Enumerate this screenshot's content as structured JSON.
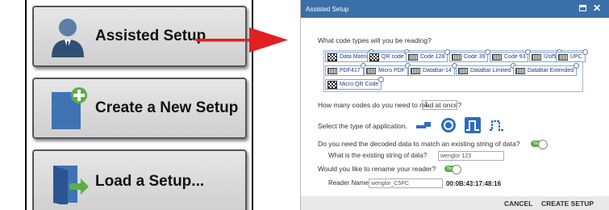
{
  "left_panel": {
    "buttons": [
      {
        "label": "Assisted Setup",
        "icon": "user-icon"
      },
      {
        "label": "Create a New Setup",
        "icon": "new-document-icon"
      },
      {
        "label": "Load a Setup...",
        "icon": "open-door-icon"
      }
    ]
  },
  "arrow": {
    "color": "#e02020"
  },
  "dialog": {
    "title": "Assisted Setup",
    "q_codes": "What code types will you be reading?",
    "code_types": [
      "Data Matrix",
      "QR code",
      "Code 128",
      "Code 39",
      "Code 93",
      "I2of5",
      "UPC",
      "PDF417",
      "Micro PDF",
      "DataBar-14",
      "DataBar Limited",
      "DataBar Extended",
      "Micro QR Code"
    ],
    "q_count": "How many codes do you need to read at once?",
    "count_value": "1",
    "q_app": "Select the type of application.",
    "app_icons": [
      "conveyor-icon",
      "rotation-icon",
      "pulse-selected-icon",
      "pulse-icon"
    ],
    "q_match": "Do you need the decoded data to match an existing string of data?",
    "toggle_label": "Yes",
    "q_existing": "What is the existing string of data?",
    "existing_value": "wenglor 123",
    "q_rename": "Would you like to rename your reader?",
    "reader_name_label": "Reader Name",
    "reader_name_value": "wenglor_C5PC",
    "mac": "00:0B:43:17:48:16",
    "cancel": "CANCEL",
    "create": "CREATE SETUP",
    "colors": {
      "header": "#3b6fa8",
      "toggle": "#5ab040",
      "selected": "#2d6cc0"
    }
  }
}
